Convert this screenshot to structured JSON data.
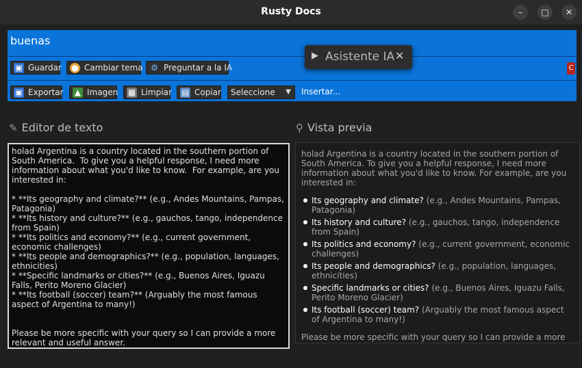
{
  "window": {
    "title": "Rusty Docs"
  },
  "toolbar": {
    "query": "buenas",
    "save_label": "Guardar",
    "theme_label": "Cambiar tema",
    "ask_label": "Preguntar a la IA",
    "export_label": "Exportar",
    "image_label": "Imagen",
    "clear_label": "Limpiar",
    "copy_label": "Copiar",
    "select_value": "Seleccione",
    "insert_label": "Insertar...",
    "red_button_label": "C"
  },
  "assistant_popup": {
    "label": "Asistente IA"
  },
  "editor": {
    "heading": "Editor de texto",
    "content": "holad Argentina is a country located in the southern portion of South America.  To give you a helpful response, I need more information about what you'd like to know.  For example, are you interested in:\n\n* **Its geography and climate?** (e.g., Andes Mountains, Pampas, Patagonia)\n* **Its history and culture?** (e.g., gauchos, tango, independence from Spain)\n* **Its politics and economy?** (e.g., current government, economic challenges)\n* **Its people and demographics?** (e.g., population, languages, ethnicities)\n* **Specific landmarks or cities?** (e.g., Buenos Aires, Iguazu Falls, Perito Moreno Glacier)\n* **Its football (soccer) team?** (Arguably the most famous aspect of Argentina to many!)\n\n\nPlease be more specific with your query so I can provide a more relevant and useful answer."
  },
  "preview": {
    "heading": "Vista previa",
    "intro": "holad Argentina is a country located in the southern portion of South America.  To give you a helpful response, I need more information about what you'd like to know.  For example, are you interested in:",
    "items": [
      {
        "strong": "Its geography and climate?",
        "rest": " (e.g., Andes Mountains, Pampas, Patagonia)"
      },
      {
        "strong": "Its history and culture?",
        "rest": " (e.g., gauchos, tango, independence from Spain)"
      },
      {
        "strong": "Its politics and economy?",
        "rest": " (e.g., current government, economic challenges)"
      },
      {
        "strong": "Its people and demographics?",
        "rest": " (e.g., population, languages, ethnicities)"
      },
      {
        "strong": "Specific landmarks or cities?",
        "rest": " (e.g., Buenos Aires, Iguazu Falls, Perito Moreno Glacier)"
      },
      {
        "strong": "Its football (soccer) team?",
        "rest": " (Arguably the most famous aspect of Argentina to many!)"
      }
    ],
    "outro": "Please be more specific with your query so I can provide a more relevant and useful answer."
  },
  "icons": {
    "save": "floppy-icon",
    "theme": "palette-icon",
    "ask": "gear-icon",
    "export": "floppy-icon",
    "image": "image-icon",
    "clear": "trash-icon",
    "copy": "clipboard-icon",
    "editor": "pencil-icon",
    "preview": "magnifier-icon"
  },
  "colors": {
    "accent": "#0a74da",
    "danger": "#b3261e",
    "background": "#202020"
  }
}
